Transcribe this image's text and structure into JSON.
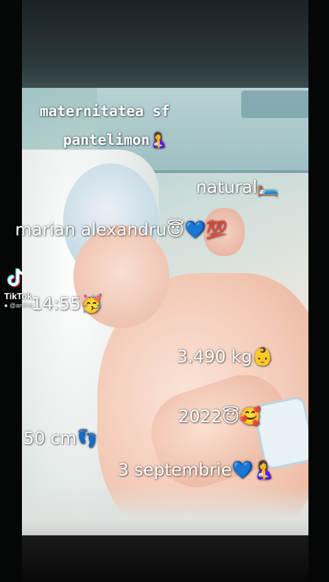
{
  "captions": {
    "line1": "maternitatea sf",
    "line2": "pantelimon🤱",
    "natural": "natural🛏️",
    "name": "marian alexandru😇💙💯",
    "time": "14:55🥳",
    "weight": "3.490 kg👶",
    "year": "2022😇🥰",
    "length": "50 cm👣",
    "date": "3 septembrie💙🤱"
  },
  "watermark": {
    "brand": "TikTok",
    "username": "@andrej"
  }
}
